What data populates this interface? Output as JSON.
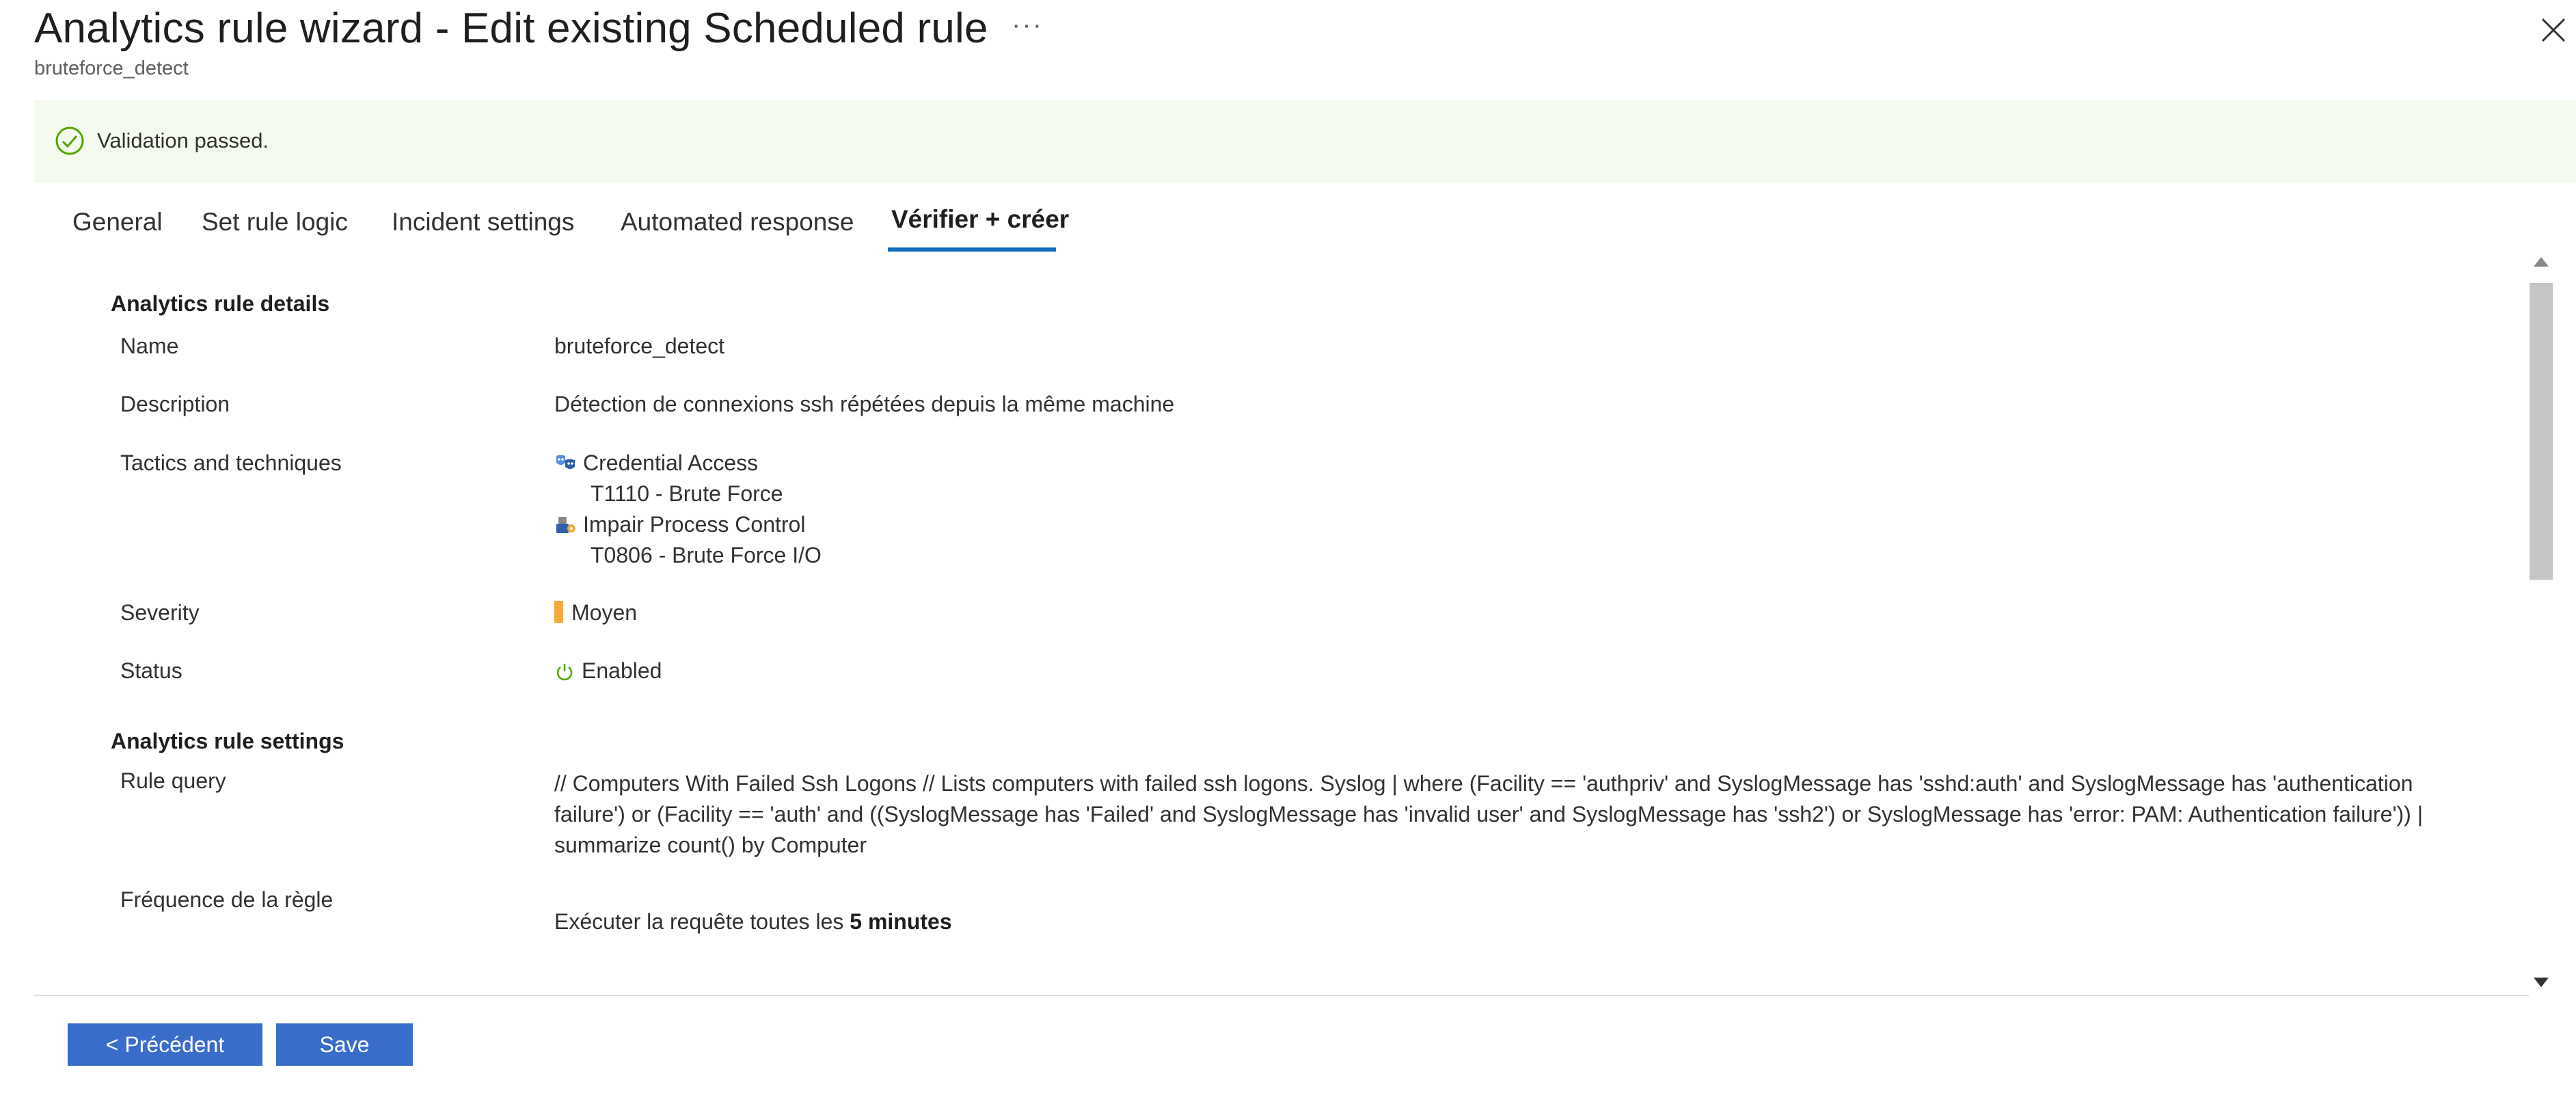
{
  "header": {
    "title": "Analytics rule wizard - Edit existing Scheduled rule",
    "more_label": "···",
    "subtitle": "bruteforce_detect"
  },
  "banner": {
    "text": "Validation passed.",
    "status_color": "#57a300"
  },
  "tabs": [
    {
      "label": "General"
    },
    {
      "label": "Set rule logic"
    },
    {
      "label": "Incident settings"
    },
    {
      "label": "Automated response"
    },
    {
      "label": "Vérifier + créer",
      "active": true
    }
  ],
  "details": {
    "section_title": "Analytics rule details",
    "name_label": "Name",
    "name_value": "bruteforce_detect",
    "description_label": "Description",
    "description_value": "Détection de connexions ssh répétées depuis la même machine",
    "tactics_label": "Tactics and techniques",
    "tactics": [
      {
        "name": "Credential Access",
        "technique": "T1110 - Brute Force",
        "icon": "credential-access-icon"
      },
      {
        "name": "Impair Process Control",
        "technique": "T0806 - Brute Force I/O",
        "icon": "impair-process-control-icon"
      }
    ],
    "severity_label": "Severity",
    "severity_value": "Moyen",
    "severity_color": "#f7a93b",
    "status_label": "Status",
    "status_value": "Enabled",
    "status_icon": "power-icon"
  },
  "settings": {
    "section_title": "Analytics rule settings",
    "query_label": "Rule query",
    "query_value": "// Computers With Failed Ssh Logons // Lists computers with failed ssh logons. Syslog | where (Facility == 'authpriv' and SyslogMessage has 'sshd:auth' and SyslogMessage has 'authentication failure') or (Facility == 'auth' and ((SyslogMessage has 'Failed' and SyslogMessage has 'invalid user' and SyslogMessage has 'ssh2') or SyslogMessage has 'error: PAM: Authentication failure')) | summarize count() by Computer",
    "frequency_label": "Fréquence de la règle",
    "frequency_prefix": "Exécuter la requête toutes les ",
    "frequency_value": "5 minutes"
  },
  "footer": {
    "prev_label": "< Précédent",
    "save_label": "Save"
  },
  "colors": {
    "accent": "#0f6cbd",
    "button": "#3a6cc9",
    "banner_bg": "#f4fbee"
  }
}
